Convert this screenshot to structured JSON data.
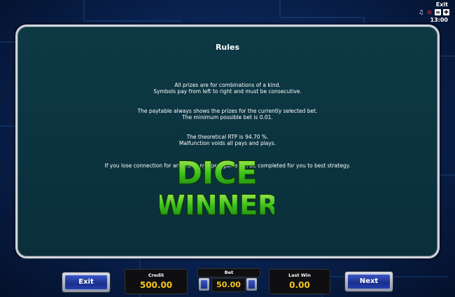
{
  "top": {
    "exit_label": "Exit",
    "clock": "13:00",
    "icons": [
      "music-icon",
      "sound-muted-icon",
      "paytable-icon",
      "settings-icon"
    ]
  },
  "rules": {
    "title": "Rules",
    "lines": [
      "All prizes are for combinations of a kind.",
      "Symbols pay from left to right and must be consecutive.",
      "The paytable always shows the prizes for the currently selected bet.",
      "The minimum possible bet is 0.01.",
      "The theoretical RTP is 94.70 %.",
      "Malfunction voids all pays and plays.",
      "If you lose connection for an hour, any open game will be completed for you to best strategy."
    ]
  },
  "logo": {
    "line1": "DICE",
    "line2": "WINNER"
  },
  "bottom": {
    "exit_label": "Exit",
    "next_label": "Next",
    "credit_label": "Credit",
    "credit_value": "500.00",
    "bet_label": "Bet",
    "bet_value": "50.00",
    "lastwin_label": "Last Win",
    "lastwin_value": "0.00"
  },
  "colors": {
    "value_yellow": "#f5c518",
    "logo_green": "#3cc21a",
    "button_blue": "#2440b0"
  }
}
